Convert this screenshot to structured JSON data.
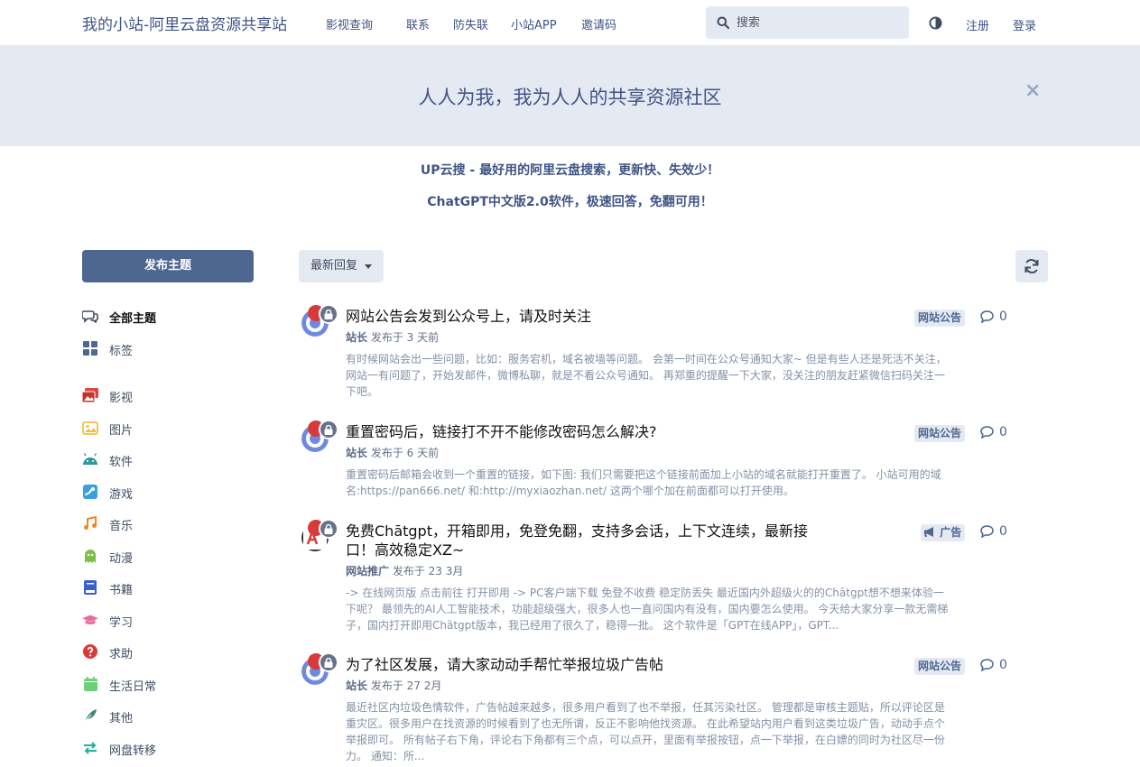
{
  "header": {
    "brand": "我的小站-阿里云盘资源共享站",
    "nav": [
      "影视查询",
      "联系",
      "防失联",
      "小站APP",
      "邀请码"
    ],
    "search_placeholder": "搜索",
    "register": "注册",
    "login": "登录"
  },
  "hero": {
    "title": "人人为我，我为人人的共享资源社区",
    "close": "×"
  },
  "announcements": [
    "UP云搜 - 最好用的阿里云盘搜索，更新快、失效少！",
    "ChatGPT中文版2.0软件，极速回答，免翻可用！"
  ],
  "sidebar": {
    "new_discussion": "发布主题",
    "items": [
      {
        "label": "全部主题",
        "icon": "comments-icon",
        "color": "#3f4c63"
      },
      {
        "label": "标签",
        "icon": "grid-icon",
        "color": "#4e6791"
      },
      {
        "label": "影视",
        "icon": "photo-film-icon",
        "color": "#e0453a"
      },
      {
        "label": "图片",
        "icon": "image-icon",
        "color": "#f0c040"
      },
      {
        "label": "软件",
        "icon": "android-icon",
        "color": "#2e9a9a"
      },
      {
        "label": "游戏",
        "icon": "steam-icon",
        "color": "#3aa0e0"
      },
      {
        "label": "音乐",
        "icon": "music-icon",
        "color": "#f0862a"
      },
      {
        "label": "动漫",
        "icon": "ghost-icon",
        "color": "#7cc04a"
      },
      {
        "label": "书籍",
        "icon": "book-icon",
        "color": "#3a5fd0"
      },
      {
        "label": "学习",
        "icon": "graduation-cap-icon",
        "color": "#e86a9a"
      },
      {
        "label": "求助",
        "icon": "question-circle-icon",
        "color": "#d83a3a"
      },
      {
        "label": "生活日常",
        "icon": "calendar-icon",
        "color": "#6ad07a"
      },
      {
        "label": "其他",
        "icon": "feather-icon",
        "color": "#3a8a6a"
      },
      {
        "label": "网盘转移",
        "icon": "exchange-icon",
        "color": "#20b0a0"
      }
    ]
  },
  "toolbar": {
    "sort_label": "最新回复"
  },
  "discussions": [
    {
      "title": "网站公告会发到公众号上，请及时关注",
      "author": "站长",
      "time": "发布于 3 天前",
      "excerpt": "有时候网站会出一些问题，比如：服务宕机，域名被墙等问题。 会第一时间在公众号通知大家~ 但是有些人还是死活不关注，网站一有问题了，开始发邮件，微博私聊，就是不看公众号通知。 再郑重的提醒一下大家，没关注的朋友赶紧微信扫码关注一下吧。",
      "tag": "网站公告",
      "replies": "0"
    },
    {
      "title": "重置密码后，链接打不开不能修改密码怎么解决?",
      "author": "站长",
      "time": "发布于 6 天前",
      "excerpt": "重置密码后邮箱会收到一个重置的链接，如下图: 我们只需要把这个链接前面加上小站的域名就能打开重置了。 小站可用的域名:https://pan666.net/ 和:http://myxiaozhan.net/ 这两个哪个加在前面都可以打开使用。",
      "tag": "网站公告",
      "replies": "0"
    },
    {
      "title": "免费Chātgpt，开箱即用，免登免翻，支持多会话，上下文连续，最新接口！高效稳定XZ~",
      "author": "网站推广",
      "time": "发布于 23 3月",
      "excerpt": "-> 在线网页版 点击前往 打开即用 -> PC客户端下载 免登不收费 稳定防丢失 最近国内外超级火的的Chātgpt想不想来体验一下呢？ 最领先的AI人工智能技术，功能超级强大，很多人也一直问国内有没有，国内要怎么使用。 今天给大家分享一款无需梯子，国内打开即用Chātgpt版本，我已经用了很久了，稳得一批。 这个软件是「GPT在线APP」，GPT...",
      "tag": "广告",
      "replies": "0"
    },
    {
      "title": "为了社区发展，请大家动动手帮忙举报垃圾广告帖",
      "author": "站长",
      "time": "发布于 27 2月",
      "excerpt": "最近社区内垃圾色情软件，广告帖越来越多，很多用户看到了也不举报，任其污染社区。 管理都是审核主题贴，所以评论区是重灾区。很多用户在找资源的时候看到了也无所谓，反正不影响他找资源。 在此希望站内用户看到这类垃圾广告，动动手点个举报即可。 所有帖子右下角，评论右下角都有三个点，可以点开，里面有举报按钮，点一下举报，在白嫖的同时为社区尽一份力。 通知：所...",
      "tag": "网站公告",
      "replies": "0"
    }
  ]
}
